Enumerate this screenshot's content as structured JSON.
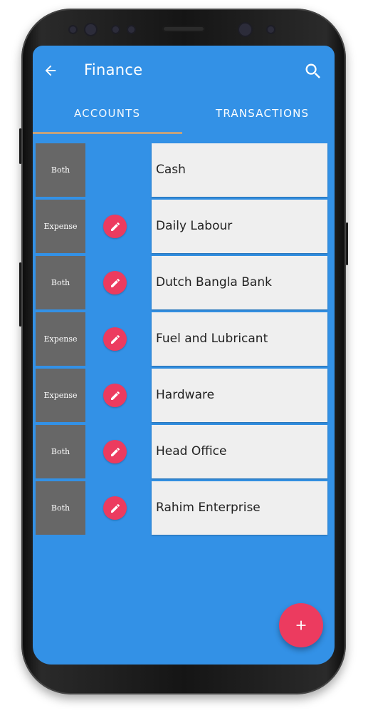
{
  "appbar": {
    "title": "Finance"
  },
  "tabs": [
    {
      "label": "ACCOUNTS",
      "selected": true
    },
    {
      "label": "TRANSACTIONS",
      "selected": false
    }
  ],
  "accounts": [
    {
      "type": "Both",
      "name": "Cash",
      "editable": false
    },
    {
      "type": "Expense",
      "name": "Daily Labour",
      "editable": true
    },
    {
      "type": "Both",
      "name": "Dutch Bangla Bank",
      "editable": true
    },
    {
      "type": "Expense",
      "name": "Fuel and Lubricant",
      "editable": true
    },
    {
      "type": "Expense",
      "name": "Hardware",
      "editable": true
    },
    {
      "type": "Both",
      "name": "Head Office",
      "editable": true
    },
    {
      "type": "Both",
      "name": "Rahim Enterprise",
      "editable": true
    }
  ],
  "icons": {
    "back": "arrow-left-icon",
    "search": "search-icon",
    "edit": "pencil-icon",
    "add": "plus-icon"
  },
  "colors": {
    "screen_bg": "#3391e6",
    "badge_bg": "#676767",
    "accent": "#ec3b5f",
    "tab_indicator": "#c1a27e",
    "card_bg": "#efefef"
  }
}
